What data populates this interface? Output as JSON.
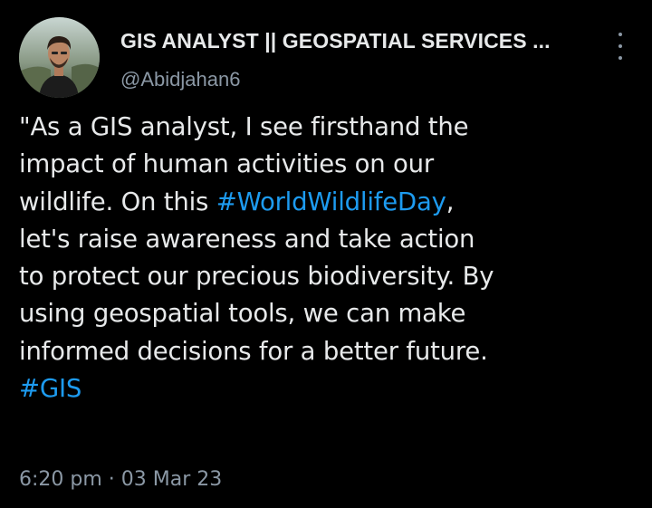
{
  "tweet": {
    "author": {
      "display_name": "GIS ANALYST || GEOSPATIAL SERVICES ...",
      "handle": "@Abidjahan6",
      "avatar_icon": "profile-photo"
    },
    "more_icon": "more-vertical-icon",
    "text_lines": [
      [
        {
          "text": "\"As a GIS analyst, I see firsthand the"
        }
      ],
      [
        {
          "text": "impact of human activities on our"
        }
      ],
      [
        {
          "text": "wildlife. On this "
        },
        {
          "text": "#WorldWildlifeDay",
          "hashtag": true
        },
        {
          "text": ","
        }
      ],
      [
        {
          "text": "let's raise awareness and take action"
        }
      ],
      [
        {
          "text": "to protect our precious biodiversity. By"
        }
      ],
      [
        {
          "text": "using geospatial tools, we can make"
        }
      ],
      [
        {
          "text": "informed decisions for a better future."
        }
      ],
      [
        {
          "text": "#GIS",
          "hashtag": true
        }
      ]
    ],
    "timestamp": "6:20 pm · 03 Mar 23"
  },
  "colors": {
    "background": "#000000",
    "text": "#e7e9ea",
    "secondary": "#8b98a5",
    "hashtag": "#1d9bf0"
  }
}
